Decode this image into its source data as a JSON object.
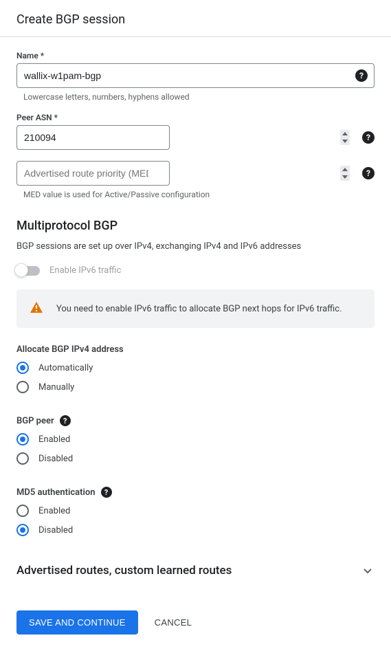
{
  "dialog": {
    "title": "Create BGP session"
  },
  "fields": {
    "name": {
      "label": "Name *",
      "value": "wallix-w1pam-bgp",
      "hint": "Lowercase letters, numbers, hyphens allowed"
    },
    "peer_asn": {
      "label": "Peer ASN *",
      "value": "210094"
    },
    "med": {
      "placeholder": "Advertised route priority (MED)",
      "hint": "MED value is used for Active/Passive configuration"
    }
  },
  "multiprotocol": {
    "title": "Multiprotocol BGP",
    "description": "BGP sessions are set up over IPv4, exchanging IPv4 and IPv6 addresses",
    "toggle_label": "Enable IPv6 traffic",
    "alert": "You need to enable IPv6 traffic to allocate BGP next hops for IPv6 traffic."
  },
  "allocate_ipv4": {
    "label": "Allocate BGP IPv4 address",
    "options": {
      "auto": "Automatically",
      "manual": "Manually"
    },
    "selected": "auto"
  },
  "bgp_peer": {
    "label": "BGP peer",
    "options": {
      "enabled": "Enabled",
      "disabled": "Disabled"
    },
    "selected": "enabled"
  },
  "md5_auth": {
    "label": "MD5 authentication",
    "options": {
      "enabled": "Enabled",
      "disabled": "Disabled"
    },
    "selected": "disabled"
  },
  "expandable": {
    "title": "Advertised routes, custom learned routes"
  },
  "buttons": {
    "save": "SAVE AND CONTINUE",
    "cancel": "CANCEL"
  }
}
